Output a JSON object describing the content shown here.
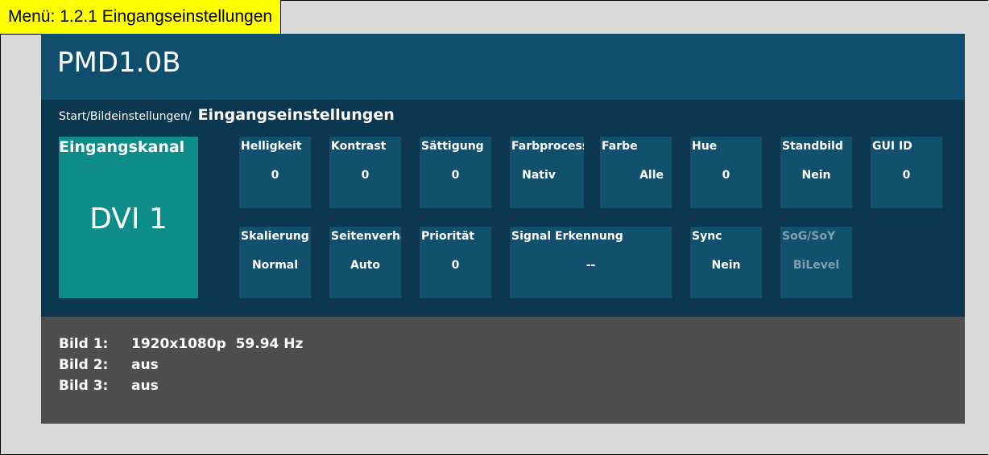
{
  "menu": {
    "label": "Menü: 1.2.1 Eingangseinstellungen"
  },
  "app": {
    "title": "PMD1.0B"
  },
  "breadcrumb": {
    "path": "Start/Bildeinstellungen/",
    "current": "Eingangseinstellungen"
  },
  "channel": {
    "label": "Eingangskanal",
    "value": "DVI 1"
  },
  "tiles_row1": [
    {
      "label": "Helligkeit",
      "value": "0"
    },
    {
      "label": "Kontrast",
      "value": "0"
    },
    {
      "label": "Sättigung",
      "value": "0"
    },
    {
      "label": "Farbprocess",
      "value": "Nativ"
    },
    {
      "label": "Farbe",
      "value": "Alle"
    },
    {
      "label": "Hue",
      "value": "0"
    },
    {
      "label": "Standbild",
      "value": "Nein"
    },
    {
      "label": "GUI ID",
      "value": "0"
    }
  ],
  "tiles_row2": [
    {
      "label": "Skalierung",
      "value": "Normal"
    },
    {
      "label": "Seitenverhältnis",
      "value": "Auto"
    },
    {
      "label": "Priorität",
      "value": "0"
    },
    {
      "label": "Signal Erkennung",
      "value": "--"
    },
    {
      "label": "Sync",
      "value": "Nein"
    },
    {
      "label": "SoG/SoY",
      "value": "BiLevel",
      "disabled": true
    }
  ],
  "status": [
    {
      "label": "Bild 1:",
      "value": "1920x1080p  59.94 Hz"
    },
    {
      "label": "Bild 2:",
      "value": "aus"
    },
    {
      "label": "Bild 3:",
      "value": "aus"
    }
  ],
  "colors": {
    "header_bg": "#0f4e6f",
    "content_bg": "#0b3850",
    "tile_bg": "#12506d",
    "channel_bg": "#0d8d8a",
    "status_bg": "#4e4e4e",
    "menu_label_bg": "#ffff00"
  }
}
